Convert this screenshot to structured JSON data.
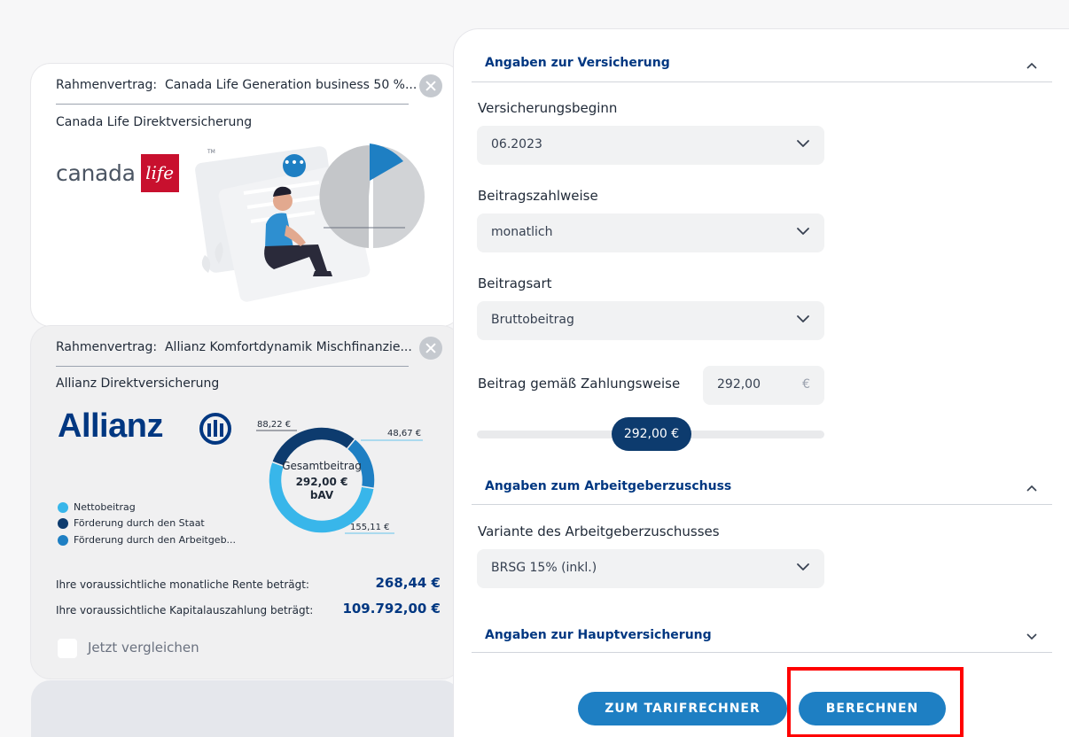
{
  "tariffs": [
    {
      "rahmenvertrag_label": "Rahmenvertrag:",
      "rahmenvertrag_name": "Canada Life Generation business 50 %...",
      "product": "Canada Life Direktversicherung",
      "logo_text": "canada",
      "logo_box_text": "life",
      "logo_tm": "TM"
    },
    {
      "rahmenvertrag_label": "Rahmenvertrag:",
      "rahmenvertrag_name": "Allianz Komfortdynamik Mischfinanzie...",
      "product": "Allianz Direktversicherung",
      "logo_text": "Allianz",
      "donut": {
        "center_title": "Gesamtbeitrag",
        "center_value": "292,00 €",
        "center_sub": "bAV",
        "slices": [
          {
            "label": "155,11 €",
            "value": 155.11,
            "color": "#38b6ea"
          },
          {
            "label": "88,22 €",
            "value": 88.22,
            "color": "#0d3b6e"
          },
          {
            "label": "48,67 €",
            "value": 48.67,
            "color": "#1e7fc3"
          }
        ]
      },
      "legend": [
        {
          "label": "Nettobeitrag",
          "color": "#38b6ea"
        },
        {
          "label": "Förderung durch den Staat",
          "color": "#0d3b6e"
        },
        {
          "label": "Förderung durch den Arbeitgeb...",
          "color": "#1e7fc3"
        }
      ],
      "rente_label": "Ihre voraussichtliche monatliche Rente beträgt:",
      "rente_value": "268,44 €",
      "kapital_label": "Ihre voraussichtliche Kapitalauszahlung beträgt:",
      "kapital_value": "109.792,00 €",
      "compare_label": "Jetzt vergleichen"
    }
  ],
  "form": {
    "section_versicherung": "Angaben zur Versicherung",
    "versicherungsbeginn_label": "Versicherungsbeginn",
    "versicherungsbeginn_value": "06.2023",
    "zahlweise_label": "Beitragszahlweise",
    "zahlweise_value": "monatlich",
    "beitragsart_label": "Beitragsart",
    "beitragsart_value": "Bruttobeitrag",
    "beitrag_label": "Beitrag gemäß Zahlungsweise",
    "beitrag_value": "292,00",
    "beitrag_unit": "€",
    "slider_value": "292,00 €",
    "section_arbeitgeber": "Angaben zum Arbeitgeberzuschuss",
    "variante_label": "Variante des Arbeitgeberzuschusses",
    "variante_value": "BRSG 15% (inkl.)",
    "section_haupt": "Angaben zur Hauptversicherung"
  },
  "buttons": {
    "tarifrechner": "ZUM TARIFRECHNER",
    "berechnen": "BERECHNEN"
  },
  "colors": {
    "primary": "#1e7fc3",
    "navy": "#003781",
    "highlight": "#ff0000"
  }
}
